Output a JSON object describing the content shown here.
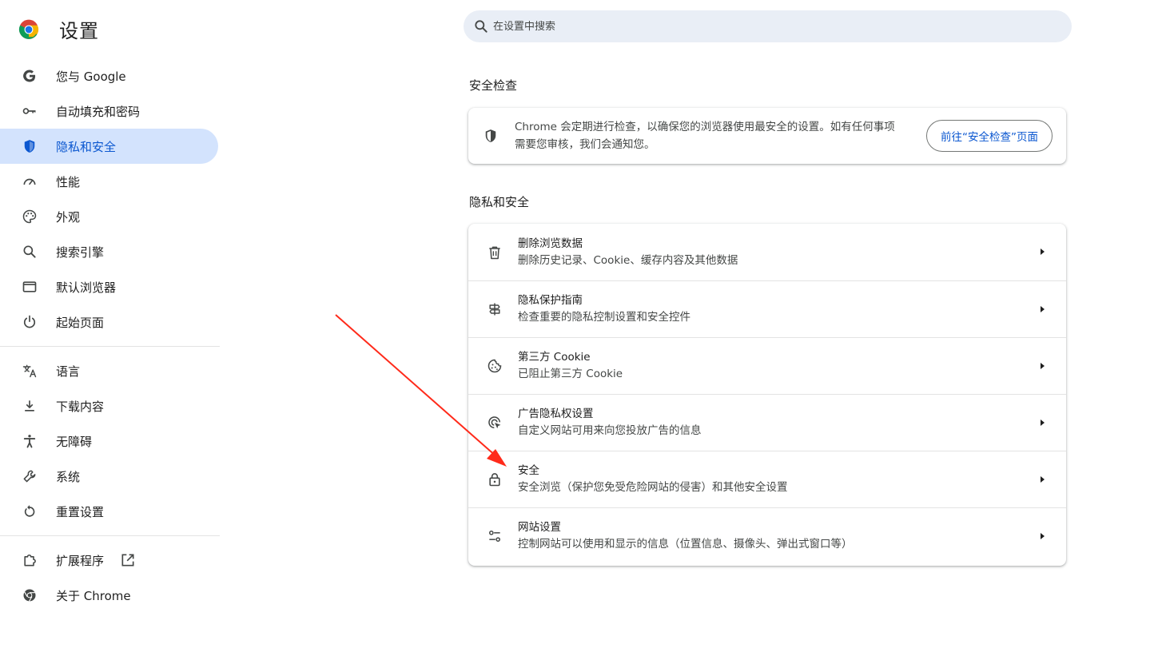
{
  "app": {
    "title": "设置"
  },
  "search": {
    "placeholder": "在设置中搜索",
    "value": ""
  },
  "sidebar": {
    "items": [
      {
        "label": "您与 Google",
        "icon": "google-g-icon"
      },
      {
        "label": "自动填充和密码",
        "icon": "key-icon"
      },
      {
        "label": "隐私和安全",
        "icon": "shield-icon",
        "active": true
      },
      {
        "label": "性能",
        "icon": "speedometer-icon"
      },
      {
        "label": "外观",
        "icon": "palette-icon"
      },
      {
        "label": "搜索引擎",
        "icon": "search-icon"
      },
      {
        "label": "默认浏览器",
        "icon": "browser-window-icon"
      },
      {
        "label": "起始页面",
        "icon": "power-icon"
      },
      {
        "label": "语言",
        "icon": "translate-icon"
      },
      {
        "label": "下载内容",
        "icon": "download-icon"
      },
      {
        "label": "无障碍",
        "icon": "accessibility-icon"
      },
      {
        "label": "系统",
        "icon": "wrench-icon"
      },
      {
        "label": "重置设置",
        "icon": "reset-icon"
      },
      {
        "label": "扩展程序",
        "icon": "puzzle-icon"
      },
      {
        "label": "关于 Chrome",
        "icon": "chrome-icon"
      }
    ]
  },
  "safety_check": {
    "heading": "安全检查",
    "description": "Chrome 会定期进行检查，以确保您的浏览器使用最安全的设置。如有任何事项需要您审核，我们会通知您。",
    "button": "前往“安全检查”页面"
  },
  "privacy": {
    "heading": "隐私和安全",
    "rows": [
      {
        "title": "删除浏览数据",
        "subtitle": "删除历史记录、Cookie、缓存内容及其他数据",
        "icon": "trash-icon"
      },
      {
        "title": "隐私保护指南",
        "subtitle": "检查重要的隐私控制设置和安全控件",
        "icon": "signpost-icon"
      },
      {
        "title": "第三方 Cookie",
        "subtitle": "已阻止第三方 Cookie",
        "icon": "cookie-icon"
      },
      {
        "title": "广告隐私权设置",
        "subtitle": "自定义网站可用来向您投放广告的信息",
        "icon": "ad-target-icon"
      },
      {
        "title": "安全",
        "subtitle": "安全浏览（保护您免受危险网站的侵害）和其他安全设置",
        "icon": "lock-icon"
      },
      {
        "title": "网站设置",
        "subtitle": "控制网站可以使用和显示的信息（位置信息、摄像头、弹出式窗口等）",
        "icon": "tune-icon"
      }
    ]
  },
  "colors": {
    "accent": "#0b57d0",
    "active_bg": "#d3e3fd",
    "search_bg": "#e9eef6",
    "arrow": "#ff2a1a"
  }
}
